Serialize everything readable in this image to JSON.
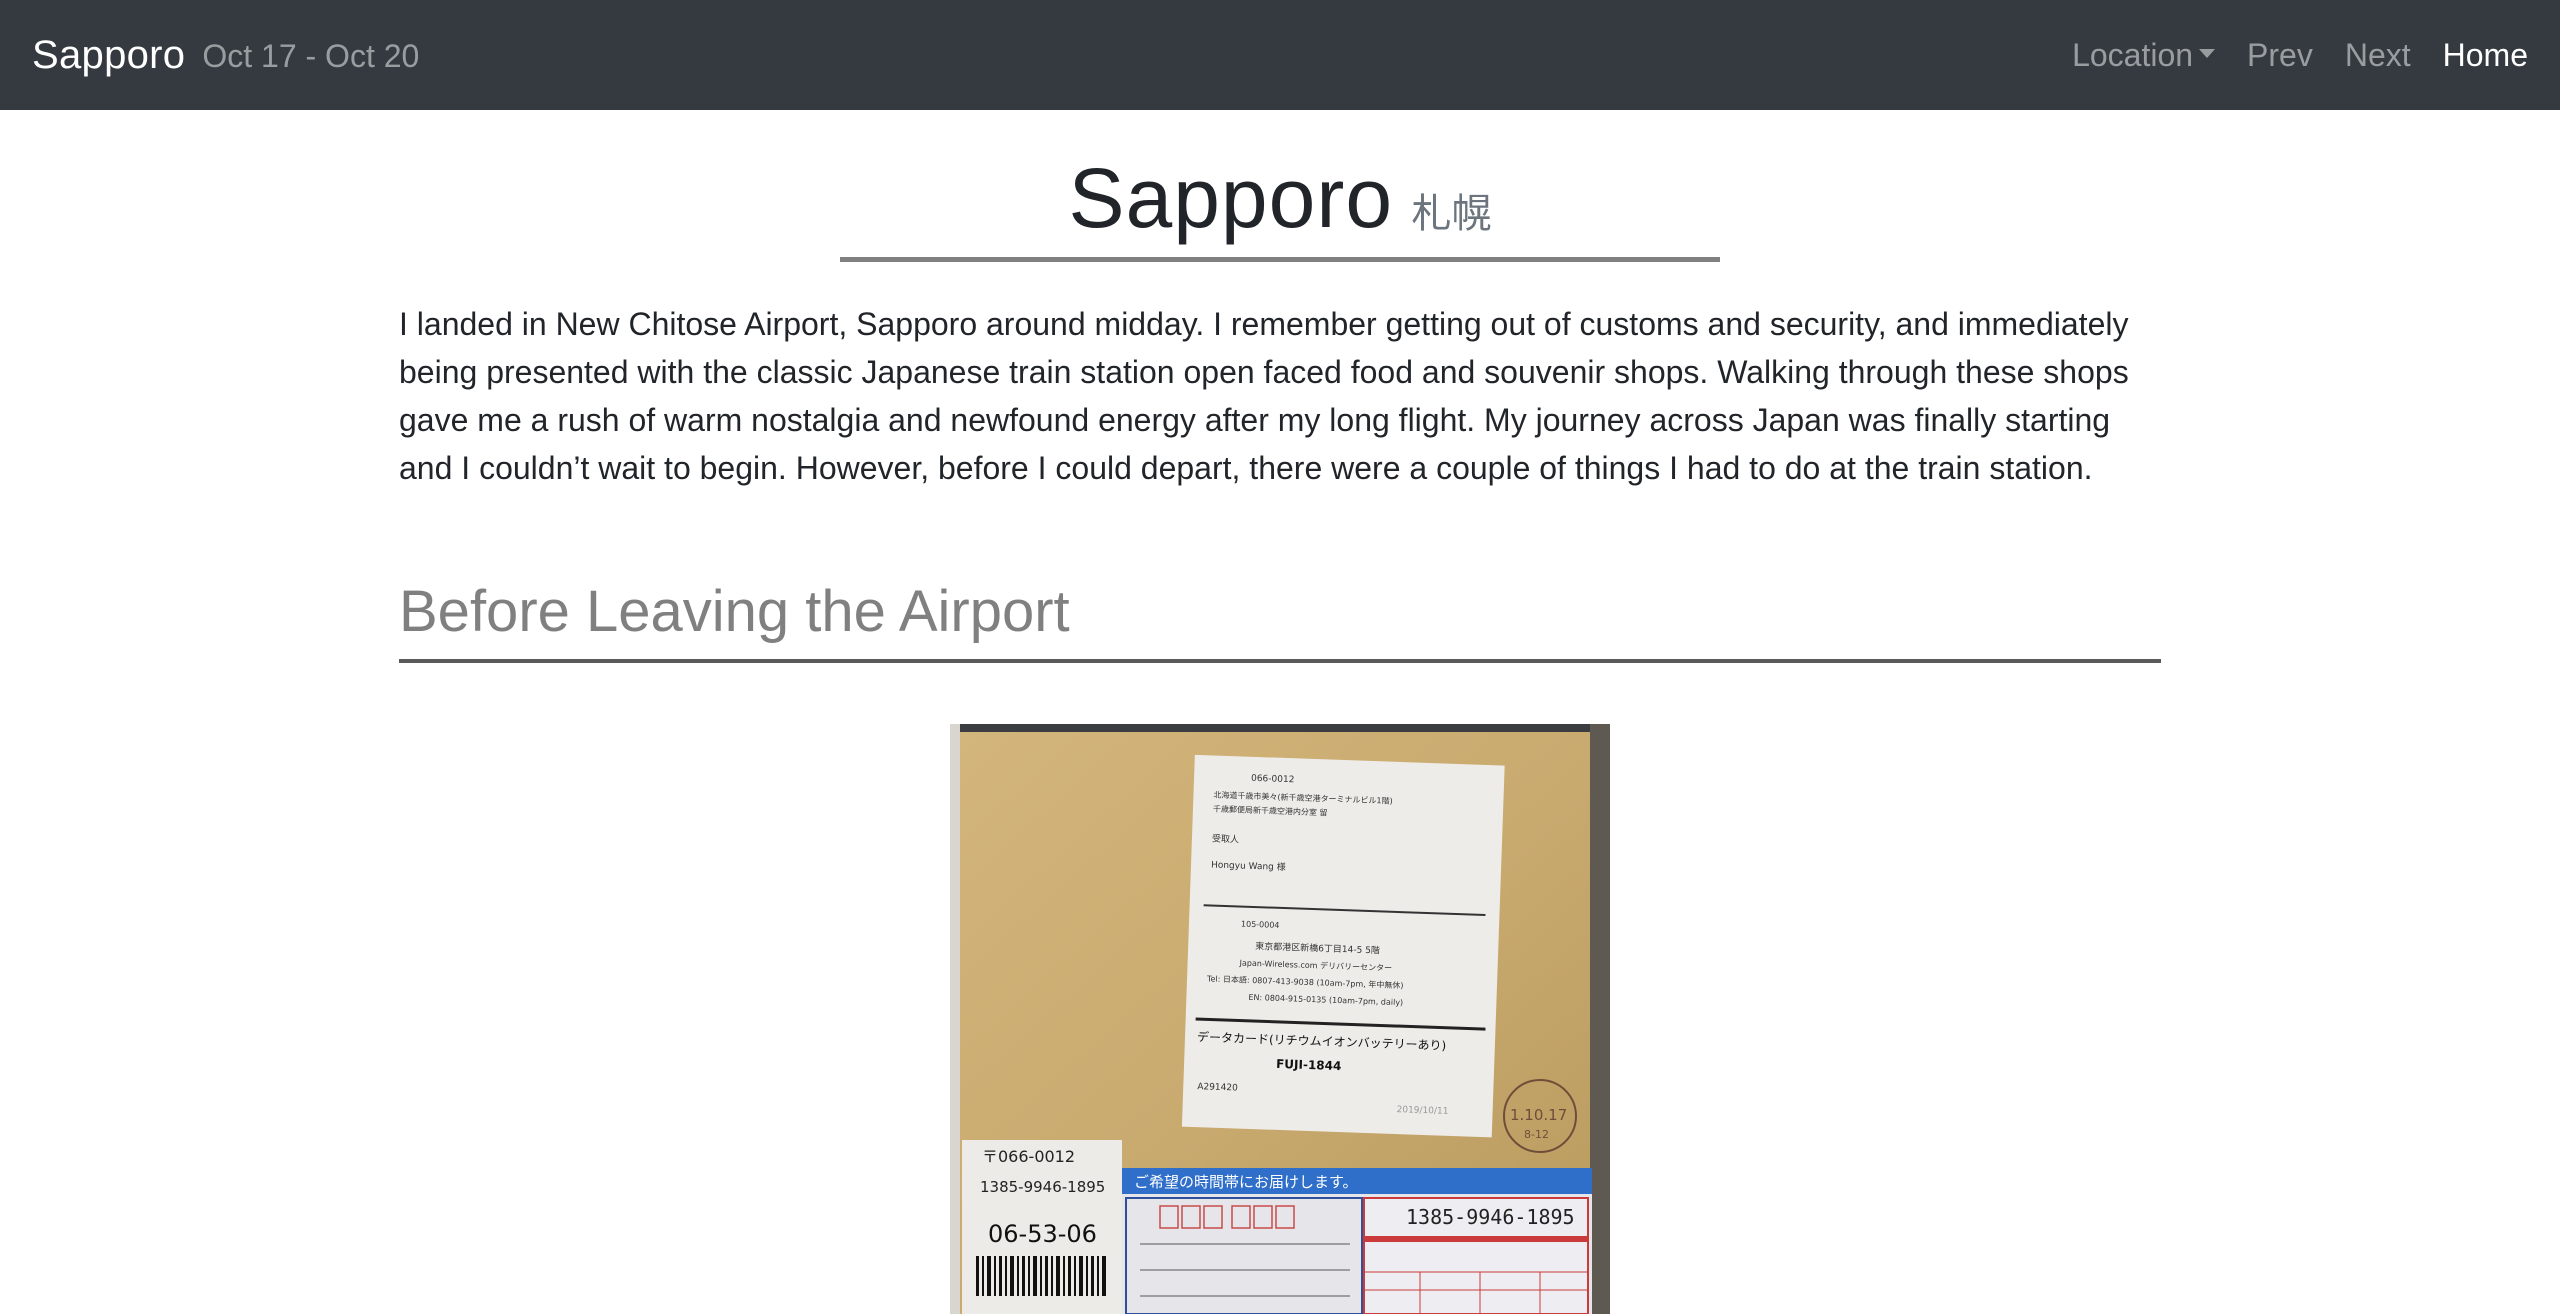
{
  "navbar": {
    "brand": "Sapporo",
    "dates": "Oct 17 - Oct 20",
    "links": {
      "location": "Location",
      "prev": "Prev",
      "next": "Next",
      "home": "Home"
    }
  },
  "page": {
    "title": "Sapporo",
    "title_jp": "札幌",
    "intro": "I landed in New Chitose Airport, Sapporo around midday. I remember getting out of customs and security, and immediately being presented with the classic Japanese train station open faced food and souvenir shops. Walking through these shops gave me a rush of warm nostalgia and newfound energy after my long flight. My journey across Japan was finally starting and I couldn’t wait to begin. However, before I could depart, there were a couple of things I had to do at the train station.",
    "section_heading": "Before Leaving the Airport"
  },
  "photo": {
    "label": {
      "postal_code": "066-0012",
      "addr_line1": "北海道千歳市美々(新千歳空港ターミナルビル1階)",
      "addr_line2": "千歳郵便局新千歳空港内分室 留",
      "recipient_label": "受取人",
      "recipient": "Hongyu Wang   様",
      "sender_postal": "105-0004",
      "sender_addr": "東京都港区新橋6丁目14-5 5階",
      "sender_company": "Japan-Wireless.com デリバリーセンター",
      "sender_tel_jp": "Tel: 日本語: 0807-413-9038 (10am-7pm, 年中無休)",
      "sender_tel_en": "EN: 0804-915-0135 (10am-7pm, daily)",
      "contents": "データカード(リチウムイオンバッテリーあり)",
      "model": "FUJI-1844",
      "code": "A291420",
      "date": "2019/10/11",
      "stamp_top": "1.10.17",
      "stamp_bottom": "8-12"
    },
    "slip": {
      "postal": "〒066-0012",
      "phone": "1385-9946-1895",
      "number": "06-53-06",
      "banner": "ご希望の時間帯にお届けします。",
      "tracking": "1385-9946-1895"
    },
    "colors": {
      "envelope": "#c6a86e",
      "banner": "#2f6fc9"
    }
  }
}
